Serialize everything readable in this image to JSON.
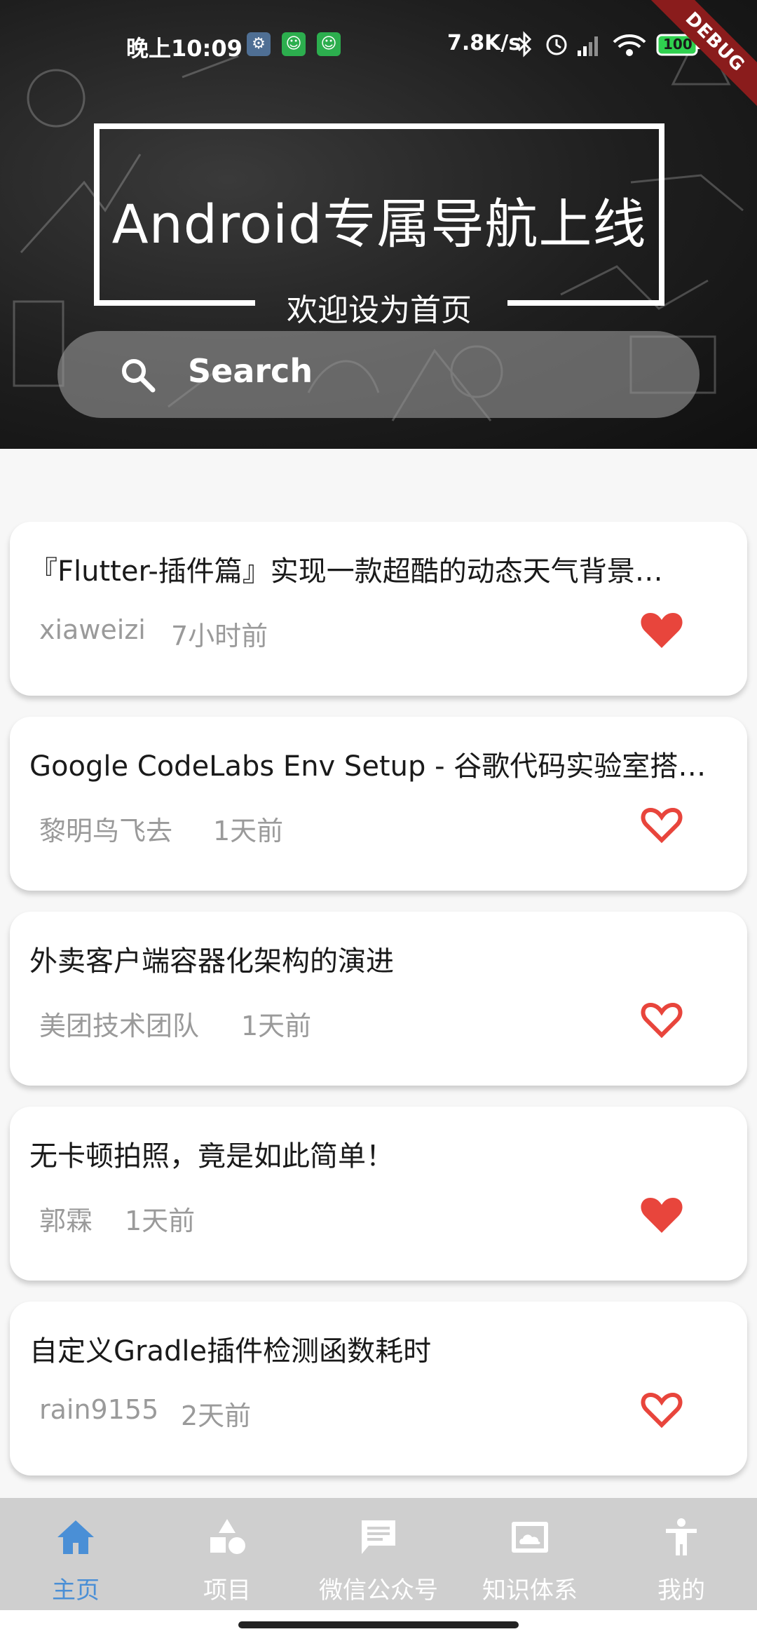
{
  "status_bar": {
    "time": "晚上10:09",
    "net_speed": "7.8K/s",
    "battery": "100"
  },
  "debug_banner": "DEBUG",
  "header": {
    "title": "Android专属导航上线",
    "subtitle": "欢迎设为首页",
    "search_label": "Search"
  },
  "articles": [
    {
      "title": "『Flutter-插件篇』实现一款超酷的动态天气背景…",
      "author": "xiaweizi",
      "time": "7小时前",
      "liked": true
    },
    {
      "title": "Google CodeLabs Env Setup - 谷歌代码实验室搭…",
      "author": "黎明鸟飞去",
      "time": "1天前",
      "liked": false
    },
    {
      "title": "外卖客户端容器化架构的演进",
      "author": "美团技术团队",
      "time": "1天前",
      "liked": false
    },
    {
      "title": "无卡顿拍照，竟是如此简单！",
      "author": "郭霖",
      "time": "1天前",
      "liked": true
    },
    {
      "title": "自定义Gradle插件检测函数耗时",
      "author": "rain9155",
      "time": "2天前",
      "liked": false
    }
  ],
  "bottom_nav": [
    {
      "label": "主页",
      "icon": "home-icon",
      "active": true
    },
    {
      "label": "项目",
      "icon": "shapes-icon",
      "active": false
    },
    {
      "label": "微信公众号",
      "icon": "chat-icon",
      "active": false
    },
    {
      "label": "知识体系",
      "icon": "picture-icon",
      "active": false
    },
    {
      "label": "我的",
      "icon": "person-icon",
      "active": false
    }
  ],
  "colors": {
    "accent": "#4a8fd6",
    "heart": "#e8453c",
    "nav_background": "#cfcfcf"
  }
}
